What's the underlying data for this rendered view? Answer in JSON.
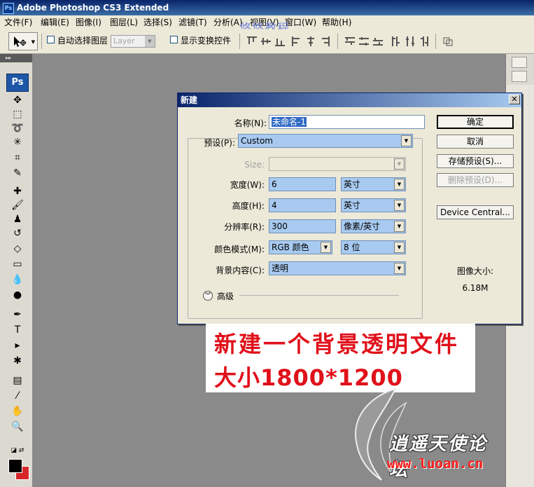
{
  "app": {
    "title": "Adobe Photoshop CS3 Extended",
    "logo_text": "Ps",
    "watermark": "悠悠教程"
  },
  "menu": [
    "文件(F)",
    "编辑(E)",
    "图像(I)",
    "图层(L)",
    "选择(S)",
    "滤镜(T)",
    "分析(A)",
    "视图(V)",
    "窗口(W)",
    "帮助(H)"
  ],
  "options": {
    "auto_select_label": "自动选择图层",
    "layer_select_value": "Layer",
    "show_transform_label": "显示变换控件"
  },
  "toolpanel": {
    "badge": "Ps"
  },
  "dialog": {
    "title": "新建",
    "name_label": "名称(N):",
    "name_value": "未命名-1",
    "preset_label": "预设(P):",
    "preset_value": "Custom",
    "size_label": "Size:",
    "size_value": "",
    "width_label": "宽度(W):",
    "width_value": "6",
    "width_unit": "英寸",
    "height_label": "高度(H):",
    "height_value": "4",
    "height_unit": "英寸",
    "resolution_label": "分辨率(R):",
    "resolution_value": "300",
    "resolution_unit": "像素/英寸",
    "color_mode_label": "颜色模式(M):",
    "color_mode_value": "RGB 颜色",
    "bit_depth_value": "8 位",
    "background_label": "背景内容(C):",
    "background_value": "透明",
    "advanced_label": "高级",
    "ok_button": "确定",
    "cancel_button": "取消",
    "save_preset_button": "存储预设(S)...",
    "delete_preset_button": "删除预设(D)...",
    "device_central_button": "Device Central...",
    "image_size_label": "图像大小:",
    "image_size_value": "6.18M"
  },
  "annotation": {
    "line1": "新建一个背景透明文件",
    "line2": "大小1800*1200"
  },
  "logo": {
    "text": "逍遥天使论坛",
    "url": "www.luoan.cn"
  },
  "colors": {
    "foreground": "#000000",
    "background": "#d6262a",
    "annotation": "#e0101a",
    "selection": "#a8caf0"
  }
}
